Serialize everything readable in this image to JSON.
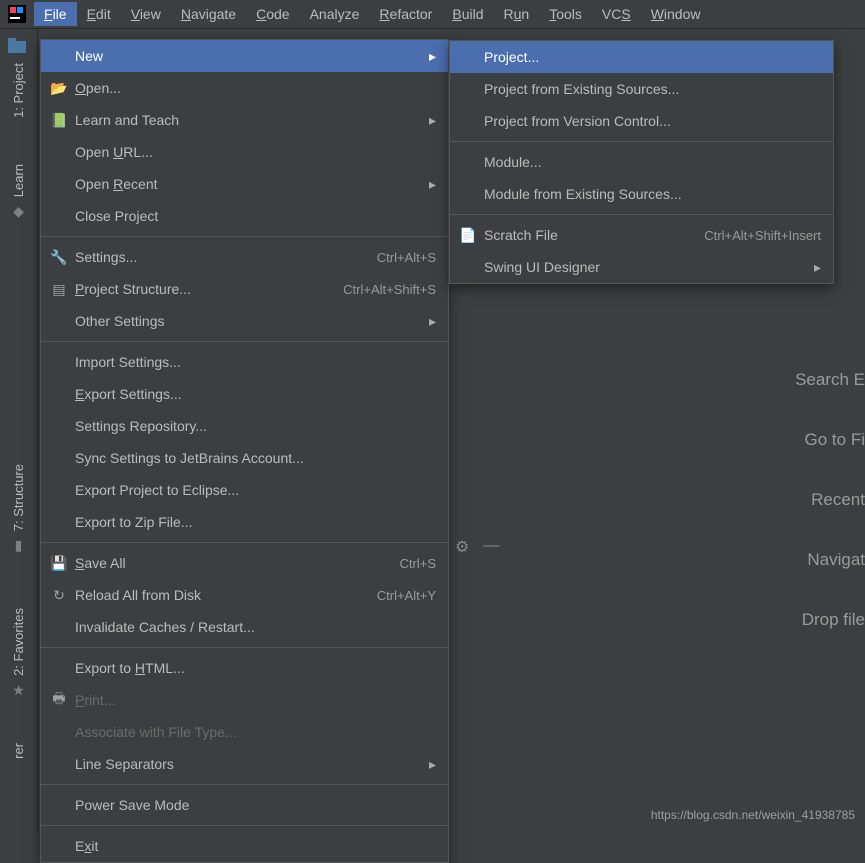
{
  "menubar": [
    "File",
    "Edit",
    "View",
    "Navigate",
    "Code",
    "Analyze",
    "Refactor",
    "Build",
    "Run",
    "Tools",
    "VCS",
    "Window"
  ],
  "menubar_mnemonic": [
    "F",
    "E",
    "V",
    "N",
    "C",
    null,
    "R",
    "B",
    "u",
    "T",
    "S",
    "W"
  ],
  "rail": {
    "project": "1: Project",
    "learn": "Learn",
    "structure": "7: Structure",
    "favorites": "2: Favorites",
    "rer": "rer"
  },
  "file_menu": [
    {
      "label": "New",
      "icon": "",
      "chevron": true,
      "highlight": true
    },
    {
      "label": "Open...",
      "icon": "📂",
      "mnemonic": "O"
    },
    {
      "label": "Learn and Teach",
      "icon": "📗",
      "chevron": true
    },
    {
      "label": "Open URL...",
      "mnemonic": "U"
    },
    {
      "label": "Open Recent",
      "mnemonic": "R",
      "chevron": true
    },
    {
      "label": "Close Project"
    },
    {
      "sep": true
    },
    {
      "label": "Settings...",
      "icon": "🔧",
      "shortcut": "Ctrl+Alt+S"
    },
    {
      "label": "Project Structure...",
      "icon": "▤",
      "shortcut": "Ctrl+Alt+Shift+S",
      "mnemonic": "P"
    },
    {
      "label": "Other Settings",
      "chevron": true
    },
    {
      "sep": true
    },
    {
      "label": "Import Settings..."
    },
    {
      "label": "Export Settings...",
      "mnemonic": "E"
    },
    {
      "label": "Settings Repository..."
    },
    {
      "label": "Sync Settings to JetBrains Account..."
    },
    {
      "label": "Export Project to Eclipse..."
    },
    {
      "label": "Export to Zip File..."
    },
    {
      "sep": true
    },
    {
      "label": "Save All",
      "icon": "💾",
      "shortcut": "Ctrl+S",
      "mnemonic": "S"
    },
    {
      "label": "Reload All from Disk",
      "icon": "↻",
      "shortcut": "Ctrl+Alt+Y"
    },
    {
      "label": "Invalidate Caches / Restart..."
    },
    {
      "sep": true
    },
    {
      "label": "Export to HTML...",
      "mnemonic": "H"
    },
    {
      "label": "Print...",
      "icon": "🖶",
      "mnemonic": "P",
      "disabled": true
    },
    {
      "label": "Associate with File Type...",
      "disabled": true
    },
    {
      "label": "Line Separators",
      "chevron": true
    },
    {
      "sep": true
    },
    {
      "label": "Power Save Mode"
    },
    {
      "sep": true
    },
    {
      "label": "Exit",
      "mnemonic": "x"
    }
  ],
  "new_submenu": [
    {
      "label": "Project...",
      "highlight": true
    },
    {
      "label": "Project from Existing Sources..."
    },
    {
      "label": "Project from Version Control..."
    },
    {
      "sep": true
    },
    {
      "label": "Module..."
    },
    {
      "label": "Module from Existing Sources..."
    },
    {
      "sep": true
    },
    {
      "label": "Scratch File",
      "icon": "📄",
      "shortcut": "Ctrl+Alt+Shift+Insert"
    },
    {
      "label": "Swing UI Designer",
      "chevron": true
    }
  ],
  "welcome": [
    "Search E",
    "Go to Fi",
    "Recent ",
    "Navigat",
    "Drop file"
  ],
  "watermark": "https://blog.csdn.net/weixin_41938785"
}
